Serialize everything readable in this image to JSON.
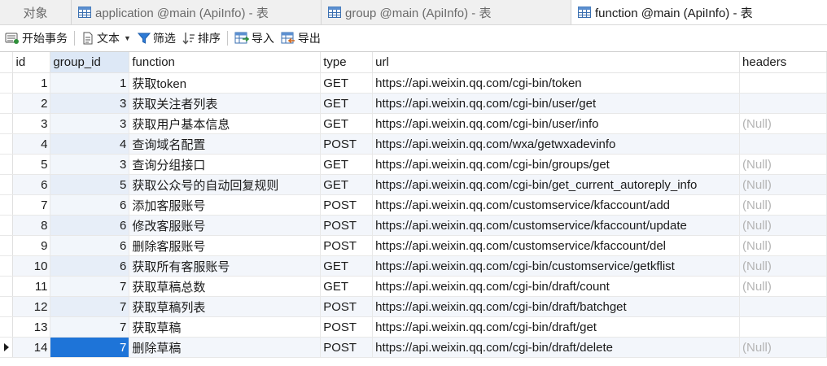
{
  "tabs": [
    {
      "label": "对象",
      "active": false,
      "icon": "none"
    },
    {
      "label": "application @main (ApiInfo) - 表",
      "active": false,
      "icon": "table-icon"
    },
    {
      "label": "group @main (ApiInfo) - 表",
      "active": false,
      "icon": "table-icon"
    },
    {
      "label": "function @main (ApiInfo) - 表",
      "active": true,
      "icon": "table-icon"
    }
  ],
  "toolbar": {
    "begin_transaction": "开始事务",
    "text": "文本",
    "filter": "筛选",
    "sort": "排序",
    "import": "导入",
    "export": "导出"
  },
  "grid": {
    "columns": [
      "id",
      "group_id",
      "function",
      "type",
      "url",
      "headers"
    ],
    "selected_column": "group_id",
    "null_text": "(Null)",
    "current_row": 14,
    "selected_cell": {
      "row": 14,
      "column": "group_id"
    },
    "rows": [
      {
        "id": "1",
        "group_id": "1",
        "function": "获取token",
        "type": "GET",
        "url": "https://api.weixin.qq.com/cgi-bin/token",
        "headers": ""
      },
      {
        "id": "2",
        "group_id": "3",
        "function": "获取关注者列表",
        "type": "GET",
        "url": "https://api.weixin.qq.com/cgi-bin/user/get",
        "headers": ""
      },
      {
        "id": "3",
        "group_id": "3",
        "function": "获取用户基本信息",
        "type": "GET",
        "url": "https://api.weixin.qq.com/cgi-bin/user/info",
        "headers": "(Null)"
      },
      {
        "id": "4",
        "group_id": "4",
        "function": "查询域名配置",
        "type": "POST",
        "url": "https://api.weixin.qq.com/wxa/getwxadevinfo",
        "headers": ""
      },
      {
        "id": "5",
        "group_id": "3",
        "function": "查询分组接口",
        "type": "GET",
        "url": "https://api.weixin.qq.com/cgi-bin/groups/get",
        "headers": "(Null)"
      },
      {
        "id": "6",
        "group_id": "5",
        "function": "获取公众号的自动回复规则",
        "type": "GET",
        "url": "https://api.weixin.qq.com/cgi-bin/get_current_autoreply_info",
        "headers": "(Null)"
      },
      {
        "id": "7",
        "group_id": "6",
        "function": "添加客服账号",
        "type": "POST",
        "url": "https://api.weixin.qq.com/customservice/kfaccount/add",
        "headers": "(Null)"
      },
      {
        "id": "8",
        "group_id": "6",
        "function": "修改客服账号",
        "type": "POST",
        "url": "https://api.weixin.qq.com/customservice/kfaccount/update",
        "headers": "(Null)"
      },
      {
        "id": "9",
        "group_id": "6",
        "function": "删除客服账号",
        "type": "POST",
        "url": "https://api.weixin.qq.com/customservice/kfaccount/del",
        "headers": "(Null)"
      },
      {
        "id": "10",
        "group_id": "6",
        "function": "获取所有客服账号",
        "type": "GET",
        "url": "https://api.weixin.qq.com/cgi-bin/customservice/getkflist",
        "headers": "(Null)"
      },
      {
        "id": "11",
        "group_id": "7",
        "function": "获取草稿总数",
        "type": "GET",
        "url": "https://api.weixin.qq.com/cgi-bin/draft/count",
        "headers": "(Null)"
      },
      {
        "id": "12",
        "group_id": "7",
        "function": "获取草稿列表",
        "type": "POST",
        "url": "https://api.weixin.qq.com/cgi-bin/draft/batchget",
        "headers": ""
      },
      {
        "id": "13",
        "group_id": "7",
        "function": "获取草稿",
        "type": "POST",
        "url": "https://api.weixin.qq.com/cgi-bin/draft/get",
        "headers": ""
      },
      {
        "id": "14",
        "group_id": "7",
        "function": "删除草稿",
        "type": "POST",
        "url": "https://api.weixin.qq.com/cgi-bin/draft/delete",
        "headers": "(Null)"
      }
    ]
  },
  "colors": {
    "selected_cell_bg": "#1e74d8",
    "selected_header_bg": "#dde8f6",
    "null_text": "#b4b4b4",
    "alt_row_bg": "#f3f6fb"
  }
}
